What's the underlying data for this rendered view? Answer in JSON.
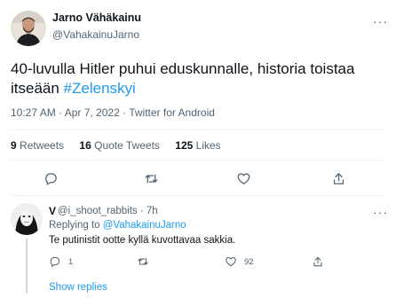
{
  "tweet": {
    "author_name": "Jarno Vähäkainu",
    "author_handle": "@VahakainuJarno",
    "more_glyph": "···",
    "text_main": "40-luvulla Hitler puhui eduskunnalle, historia toistaa itseään ",
    "hashtag": "#Zelenskyi",
    "meta": "10:27 AM · Apr 7, 2022 · Twitter for Android",
    "stats": {
      "retweets_count": "9",
      "retweets_label": "Retweets",
      "quote_count": "16",
      "quote_label": "Quote Tweets",
      "likes_count": "125",
      "likes_label": "Likes"
    },
    "actions": {
      "reply_icon": "reply-icon",
      "retweet_icon": "retweet-icon",
      "like_icon": "heart-icon",
      "share_icon": "share-icon"
    }
  },
  "reply": {
    "name": "V",
    "handle": "@i_shoot_rabbits · 7h",
    "replying_prefix": "Replying to ",
    "replying_to": "@VahakainuJarno",
    "text": "Te putinistit ootte kyllä kuvottavaa sakkia.",
    "more_glyph": "···",
    "reply_count": "1",
    "retweet_count": "",
    "like_count": "92",
    "show_replies": "Show replies"
  },
  "colors": {
    "accent": "#1d9bf0",
    "secondary_text": "#536471",
    "divider": "#eff3f4"
  }
}
